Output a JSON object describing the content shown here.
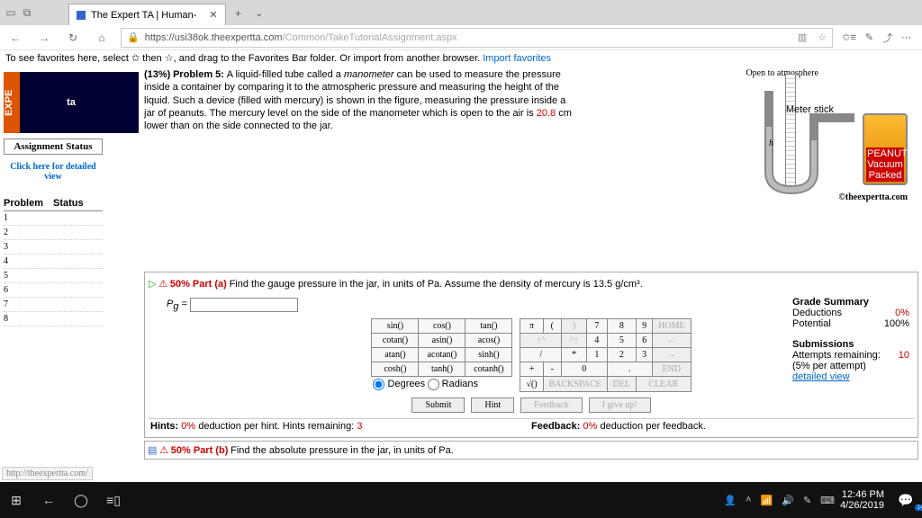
{
  "tab": {
    "title": "The Expert TA | Human-"
  },
  "url": {
    "host": "https://usi38ok.theexpertta.com",
    "path": "/Common/TakeTutorialAssignment.aspx"
  },
  "favhint": {
    "pre": "To see favorites here, select ✩ then ☆, and drag to the Favorites Bar folder. Or import from another browser. ",
    "link": "Import favorites"
  },
  "logo": {
    "text": "ta",
    "side": "EXPE"
  },
  "assign": {
    "status": "Assignment Status",
    "detail": "Click here for detailed view"
  },
  "ptable": {
    "h1": "Problem",
    "h2": "Status",
    "rows": [
      "1",
      "2",
      "3",
      "4",
      "5",
      "6",
      "7",
      "8"
    ]
  },
  "problem": {
    "pct": "(13%)",
    "num": "Problem 5:",
    "text1": "A liquid-filled tube called a ",
    "em": "manometer",
    "text2": " can be used to measure the pressure inside a container by comparing it to the atmospheric pressure and measuring the height of the liquid. Such a device (filled with mercury) is shown in the figure, measuring the pressure inside a jar of peanuts. The mercury level on the side of the manometer which is open to the air is ",
    "val": "20.8",
    "text3": " cm lower than on the side connected to the jar."
  },
  "fig": {
    "open": "Open to atmosphere",
    "meter": "Meter stick",
    "h": "h",
    "jarT": "PEANUTS",
    "jarM": "Vacuum",
    "jarB": "Packed",
    "copy": "©theexpertta.com"
  },
  "partA": {
    "pct": "50% Part (a)",
    "q": "Find the gauge pressure in the jar, in units of Pa. Assume the density of mercury is 13.5 g/cm³.",
    "var": "P_g =",
    "val": ""
  },
  "grade": {
    "h": "Grade Summary",
    "d": "Deductions",
    "dv": "0%",
    "p": "Potential",
    "pv": "100%",
    "s": "Submissions",
    "a": "Attempts remaining:",
    "av": "10",
    "per": "(5% per attempt)",
    "det": "detailed view"
  },
  "keys": {
    "row1": [
      "sin()",
      "cos()",
      "tan()",
      "π",
      "(",
      ")",
      "7",
      "8",
      "9",
      "HOME"
    ],
    "row2": [
      "cotan()",
      "asin()",
      "acos()",
      "↑^",
      "^↑",
      "4",
      "5",
      "6",
      "←"
    ],
    "row3": [
      "atan()",
      "acotan()",
      "sinh()",
      "*",
      "1",
      "2",
      "3",
      "→"
    ],
    "row4": [
      "cosh()",
      "tanh()",
      "cotanh()",
      "+",
      "-",
      "0",
      ".",
      "END"
    ],
    "row5": [
      "√()",
      "BACKSPACE",
      "DEL",
      "CLEAR"
    ],
    "mode1": "Degrees",
    "mode2": "Radians"
  },
  "btns": {
    "s": "Submit",
    "h": "Hint",
    "f": "Feedback",
    "g": "I give up!"
  },
  "hints": {
    "h": "Hints:",
    "hv": "0%",
    "ht": "deduction per hint. Hints remaining:",
    "hr": "3",
    "f": "Feedback:",
    "fv": "0%",
    "ft": "deduction per feedback."
  },
  "partB": {
    "pct": "50% Part (b)",
    "q": "Find the absolute pressure in the jar, in units of Pa."
  },
  "src": "http://theexpertta.com/",
  "clock": {
    "t": "12:46 PM",
    "d": "4/26/2019"
  }
}
